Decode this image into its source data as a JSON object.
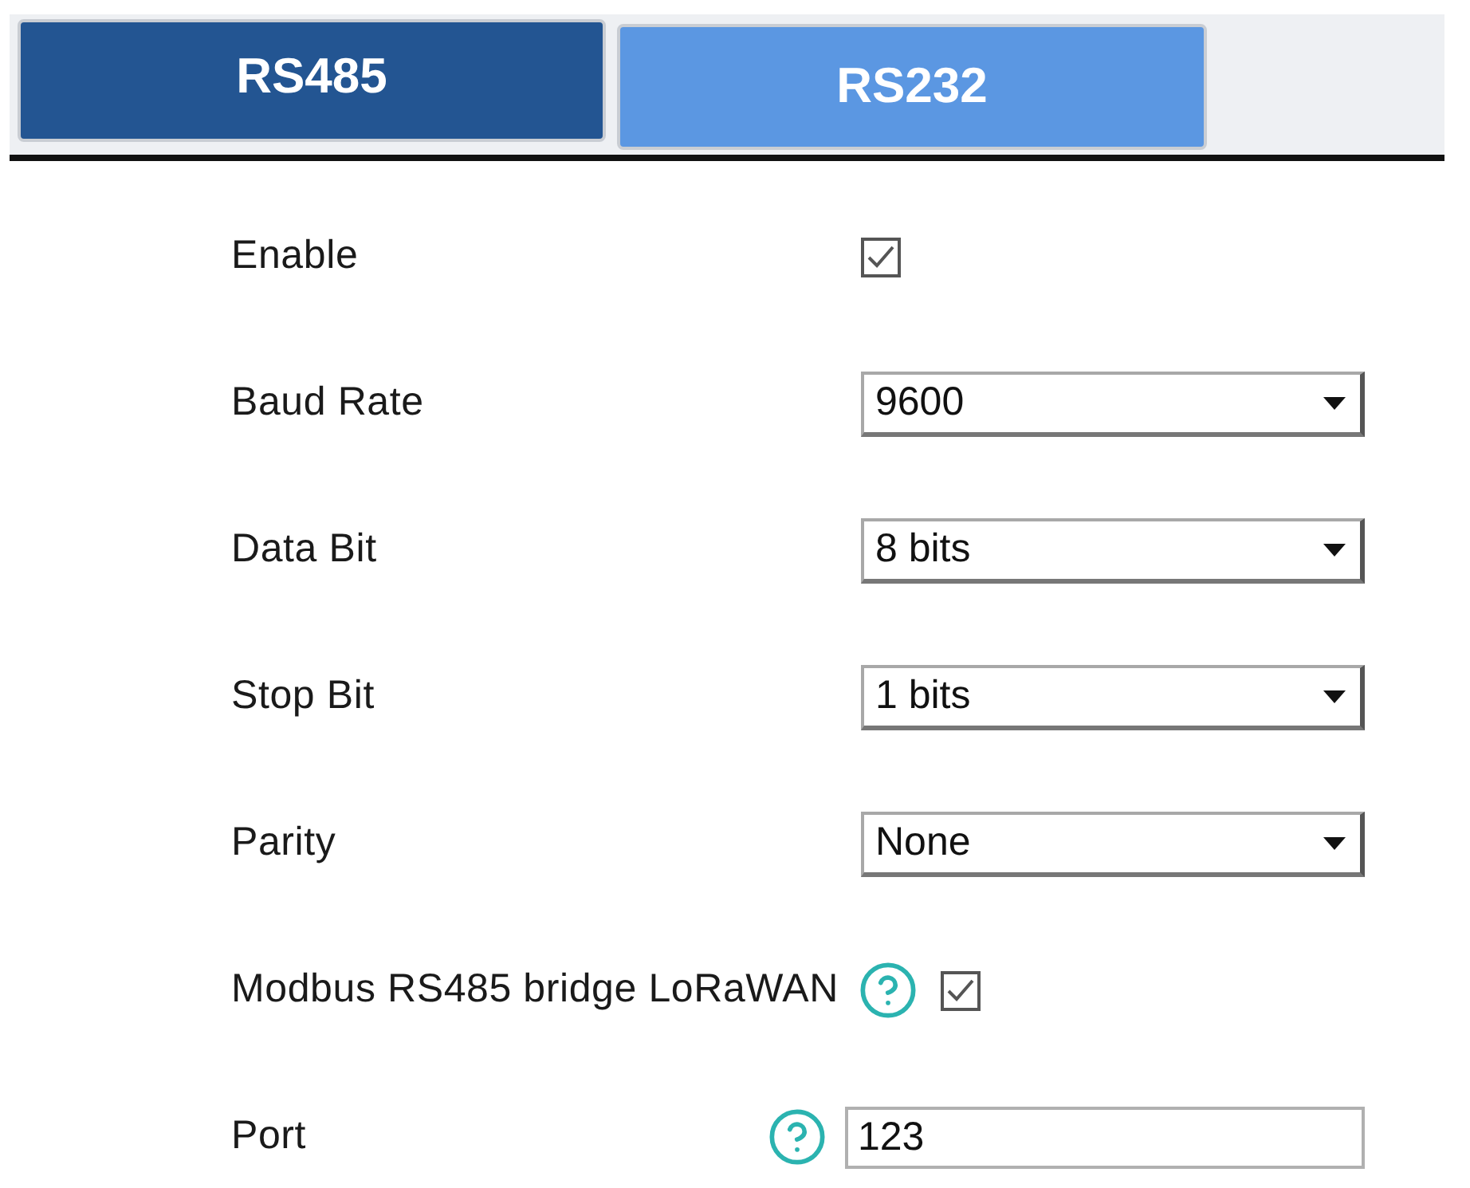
{
  "tabs": [
    {
      "label": "RS485",
      "selected": true
    },
    {
      "label": "RS232",
      "selected": false
    }
  ],
  "fields": [
    {
      "kind": "checkbox",
      "label": "Enable",
      "help": false,
      "checked": true
    },
    {
      "kind": "select",
      "label": "Baud Rate",
      "help": false,
      "value": "9600"
    },
    {
      "kind": "select",
      "label": "Data Bit",
      "help": false,
      "value": "8 bits"
    },
    {
      "kind": "select",
      "label": "Stop Bit",
      "help": false,
      "value": "1 bits"
    },
    {
      "kind": "select",
      "label": "Parity",
      "help": false,
      "value": "None"
    },
    {
      "kind": "checkbox",
      "label": "Modbus RS485 bridge LoRaWAN",
      "help": true,
      "checked": true
    },
    {
      "kind": "input",
      "label": "Port",
      "help": true,
      "value": "123"
    }
  ]
}
